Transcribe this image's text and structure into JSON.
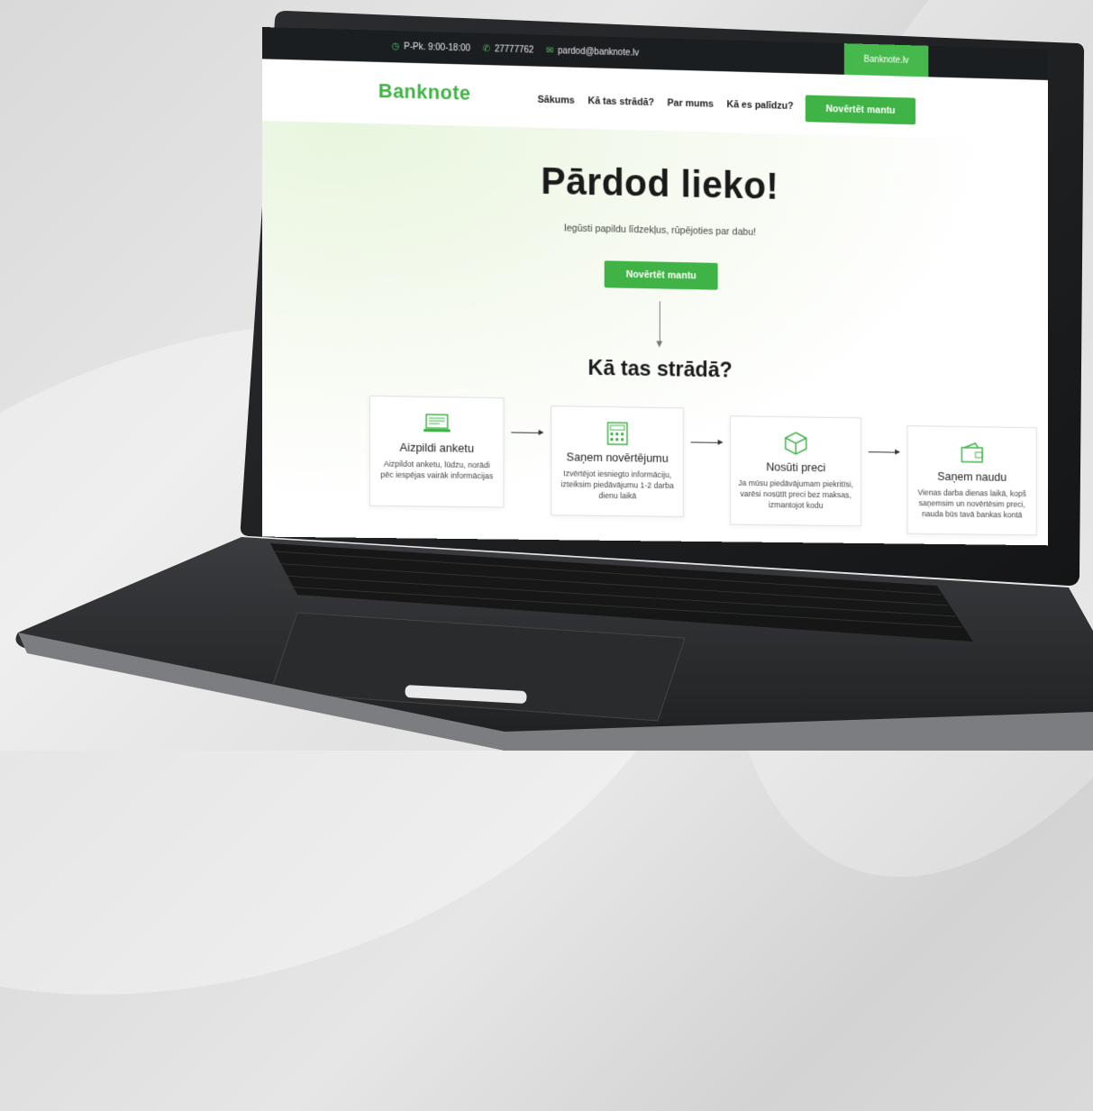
{
  "topbar": {
    "hours": "P-Pk. 9:00-18:00",
    "phone": "27777762",
    "email": "pardod@banknote.lv",
    "site_tab": "Banknote.lv"
  },
  "nav": {
    "logo": "Banknote",
    "items": [
      "Sākums",
      "Kā tas strādā?",
      "Par mums",
      "Kā es palīdzu?"
    ],
    "cta": "Novērtēt mantu"
  },
  "hero": {
    "title": "Pārdod lieko!",
    "subtitle": "Iegūsti papildu līdzekļus, rūpējoties par dabu!",
    "cta": "Novērtēt mantu"
  },
  "how": {
    "title": "Kā tas strādā?",
    "steps": [
      {
        "icon": "laptop-form-icon",
        "title": "Aizpildi anketu",
        "desc": "Aizpildot anketu, lūdzu, norādi pēc iespējas vairāk informācijas"
      },
      {
        "icon": "calculator-icon",
        "title": "Saņem novērtējumu",
        "desc": "Izvērtējot iesniegto informāciju, izteiksim piedāvājumu 1-2 darba dienu laikā"
      },
      {
        "icon": "package-icon",
        "title": "Nosūti preci",
        "desc": "Ja mūsu piedāvājumam piekritīsi, varēsi nosūtīt preci bez maksas, izmantojot kodu"
      },
      {
        "icon": "wallet-icon",
        "title": "Saņem naudu",
        "desc": "Vienas darba dienas laikā, kopš saņemsim un novērtēsim preci, nauda būs tavā bankas kontā"
      }
    ]
  },
  "colors": {
    "brand_green": "#3fb345",
    "topbar_bg": "#1b1e21"
  }
}
